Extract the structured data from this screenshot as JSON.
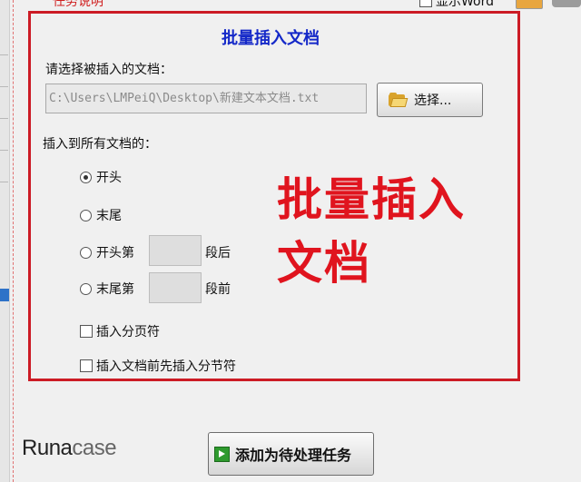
{
  "topbar": {
    "cut_title": "任务说明",
    "show_word_label": "显示Word",
    "show_word_checked": false
  },
  "dialog": {
    "title": "批量插入文档",
    "choose_label": "请选择被插入的文档：",
    "path_value": "C:\\Users\\LMPeiQ\\Desktop\\新建文本文档.txt",
    "choose_button": "选择...",
    "insert_all_label": "插入到所有文档的：",
    "options": [
      {
        "before": "开头",
        "after": "",
        "checked": true
      },
      {
        "before": "末尾",
        "after": "",
        "checked": false
      },
      {
        "before": "开头第",
        "after": "段后",
        "checked": false
      },
      {
        "before": "末尾第",
        "after": "段前",
        "checked": false
      }
    ],
    "checkboxes": [
      {
        "label": "插入分页符",
        "checked": false
      },
      {
        "label": "插入文档前先插入分节符",
        "checked": false
      }
    ]
  },
  "overlay": {
    "line1": "批量插入",
    "line2": "文档",
    "color": "#e0141e"
  },
  "footer": {
    "logo_r": "R",
    "logo_una": "una",
    "logo_case": "case",
    "add_task_button": "添加为待处理任务"
  },
  "colors": {
    "frame": "#cc1b25",
    "title": "#1428c8",
    "add_icon": "#2e9a2e"
  },
  "icons": [
    "folder-icon",
    "add-arrow-icon"
  ]
}
